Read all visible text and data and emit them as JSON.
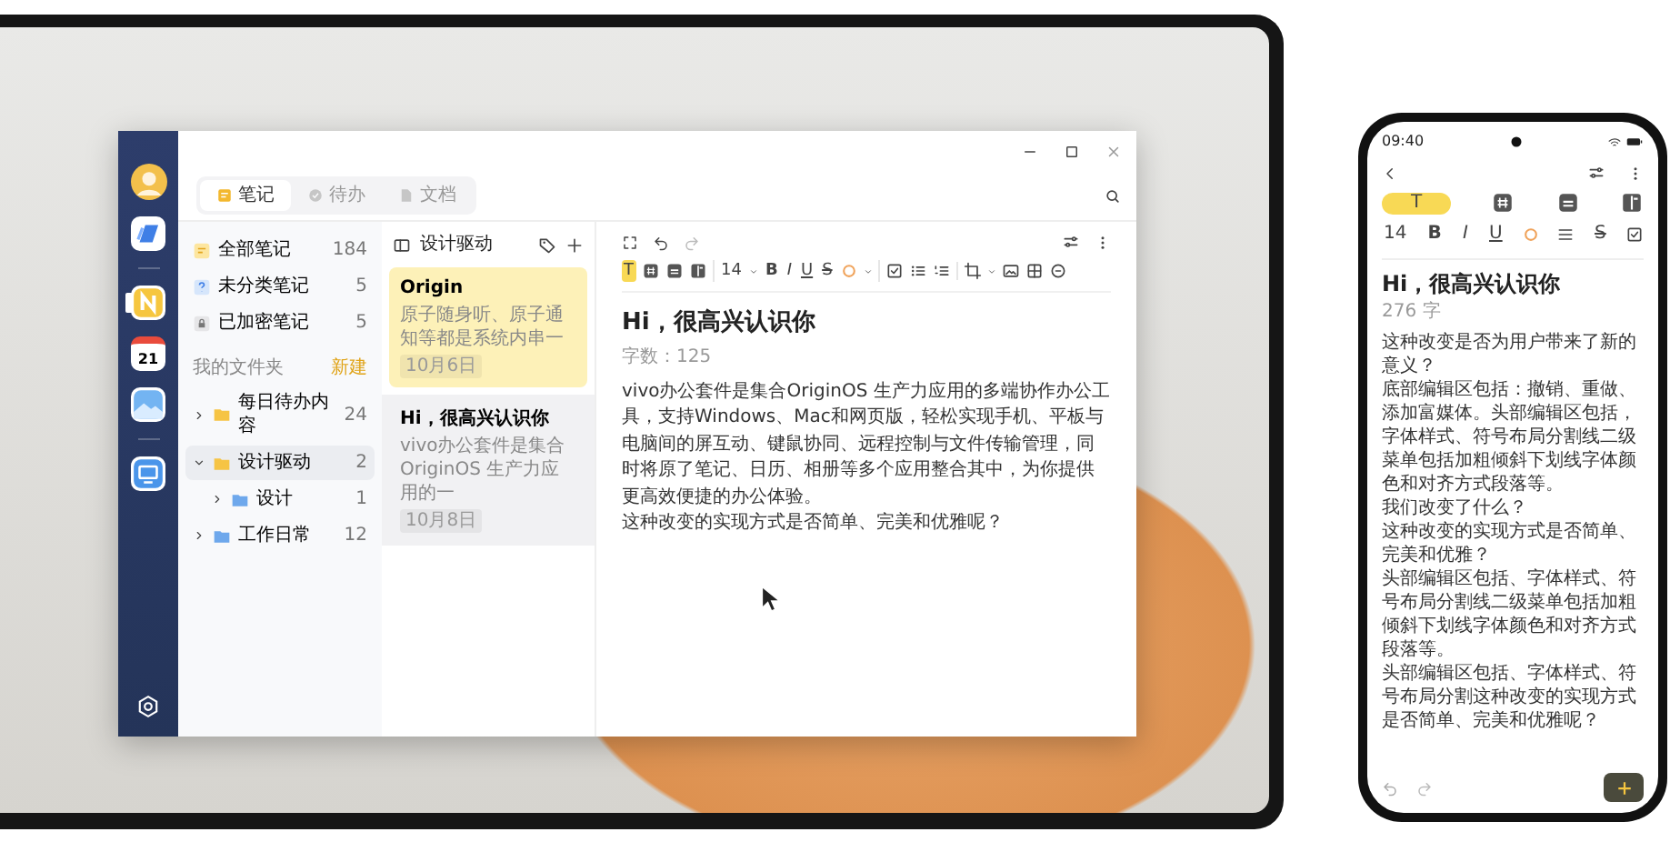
{
  "laptop": {
    "app": {
      "rail": {
        "groups": [
          [
            {
              "kind": "cloud",
              "selected": false
            }
          ],
          [
            {
              "kind": "notes",
              "selected": true
            },
            {
              "kind": "calendar",
              "label": "21",
              "selected": false
            },
            {
              "kind": "gallery",
              "selected": false
            }
          ],
          [
            {
              "kind": "screen",
              "selected": false
            }
          ]
        ]
      },
      "tabs": [
        {
          "label": "笔记",
          "kind": "note",
          "selected": true
        },
        {
          "label": "待办",
          "kind": "todo",
          "selected": false
        },
        {
          "label": "文档",
          "kind": "doc",
          "selected": false
        }
      ],
      "categories": [
        {
          "kind": "all",
          "label": "全部笔记",
          "count": "184"
        },
        {
          "kind": "unsorted",
          "label": "未分类笔记",
          "count": "5"
        },
        {
          "kind": "locked",
          "label": "已加密笔记",
          "count": "5"
        }
      ],
      "folders_heading": "我的文件夹",
      "new_folder": "新建",
      "folders": [
        {
          "label": "每日待办内容",
          "count": "24",
          "color": "#f6c444",
          "expanded": false,
          "selected": false
        },
        {
          "label": "设计驱动",
          "count": "2",
          "color": "#f6c444",
          "expanded": true,
          "selected": true,
          "children": [
            {
              "label": "设计",
              "count": "1",
              "color": "#6ea8ec",
              "expanded": false,
              "selected": false
            }
          ]
        },
        {
          "label": "工作日常",
          "count": "12",
          "color": "#6ea8ec",
          "expanded": false,
          "selected": false
        }
      ],
      "note_list": {
        "title": "设计驱动",
        "notes": [
          {
            "title": "Origin",
            "preview": "原子随身听、原子通知等都是系统内串一",
            "date": "10月6日",
            "color": "#fdf1b8",
            "selected": false
          },
          {
            "title": "Hi，很高兴认识你",
            "preview": "vivo办公套件是集合OriginOS 生产力应用的一",
            "date": "10月8日",
            "color": "#ffffff",
            "selected": true
          }
        ]
      },
      "editor": {
        "toolbar_groups": [
          [
            {
              "kind": "highlight",
              "label": "T",
              "selected": true
            },
            {
              "kind": "tag",
              "selected": false
            },
            {
              "kind": "notebox",
              "selected": false
            },
            {
              "kind": "book",
              "selected": false
            }
          ],
          [
            {
              "kind": "size",
              "label": "14",
              "selected": false
            },
            {
              "kind": "bold",
              "label": "B",
              "selected": false
            },
            {
              "kind": "italic",
              "label": "I",
              "selected": false
            },
            {
              "kind": "underline",
              "label": "U",
              "selected": false
            },
            {
              "kind": "strike",
              "label": "S",
              "selected": false
            },
            {
              "kind": "color",
              "selected": false
            }
          ],
          [
            {
              "kind": "checklist",
              "selected": false
            },
            {
              "kind": "bullets",
              "selected": false
            },
            {
              "kind": "numbered",
              "selected": false
            }
          ],
          [
            {
              "kind": "crop",
              "selected": false
            },
            {
              "kind": "image",
              "selected": false
            },
            {
              "kind": "table",
              "selected": false
            },
            {
              "kind": "more",
              "selected": false
            }
          ]
        ],
        "title": "Hi，很高兴认识你",
        "meta": "字数：125",
        "paragraphs": [
          "vivo办公套件是集合OriginOS 生产力应用的多端协作办公工具，支持Windows、Mac和网页版，轻松实现手机、平板与电脑间的屏互动、键鼠协同、远程控制与文件传输管理，同时将原了笔记、日历、相册等多个应用整合其中，为你提供更高效便捷的办公体验。",
          "这种改变的实现方式是否简单、完美和优雅呢？"
        ]
      }
    }
  },
  "phone": {
    "time": "09:40",
    "toolbar_rows": [
      [
        {
          "kind": "highlight",
          "label": "T",
          "selected": true
        },
        {
          "kind": "tag",
          "selected": false
        },
        {
          "kind": "notebox",
          "selected": false
        },
        {
          "kind": "book",
          "selected": false
        }
      ],
      [
        {
          "kind": "size",
          "label": "14",
          "selected": false
        },
        {
          "kind": "bold",
          "label": "B",
          "selected": false
        },
        {
          "kind": "italic",
          "label": "I",
          "selected": false
        },
        {
          "kind": "underline",
          "label": "U",
          "selected": false
        },
        {
          "kind": "color",
          "selected": false
        },
        {
          "kind": "align",
          "selected": false
        },
        {
          "kind": "strike",
          "label": "S",
          "selected": false
        },
        {
          "kind": "checklist",
          "selected": false
        }
      ]
    ],
    "title": "Hi，很高兴认识你",
    "meta": "276 字",
    "paragraphs": [
      "这种改变是否为用户带来了新的意义？",
      "底部编辑区包括：撤销、重做、添加富媒体。头部编辑区包括，字体样式、符号布局分割线二级菜单包括加粗倾斜下划线字体颜色和对齐方式段落等。",
      "我们改变了什么？",
      "这种改变的实现方式是否简单、完美和优雅？",
      "头部编辑区包括、字体样式、符号布局分割线二级菜单包括加粗倾斜下划线字体颜色和对齐方式段落等。",
      "头部编辑区包括、字体样式、符号布局分割这种改变的实现方式是否简单、完美和优雅呢？"
    ]
  }
}
